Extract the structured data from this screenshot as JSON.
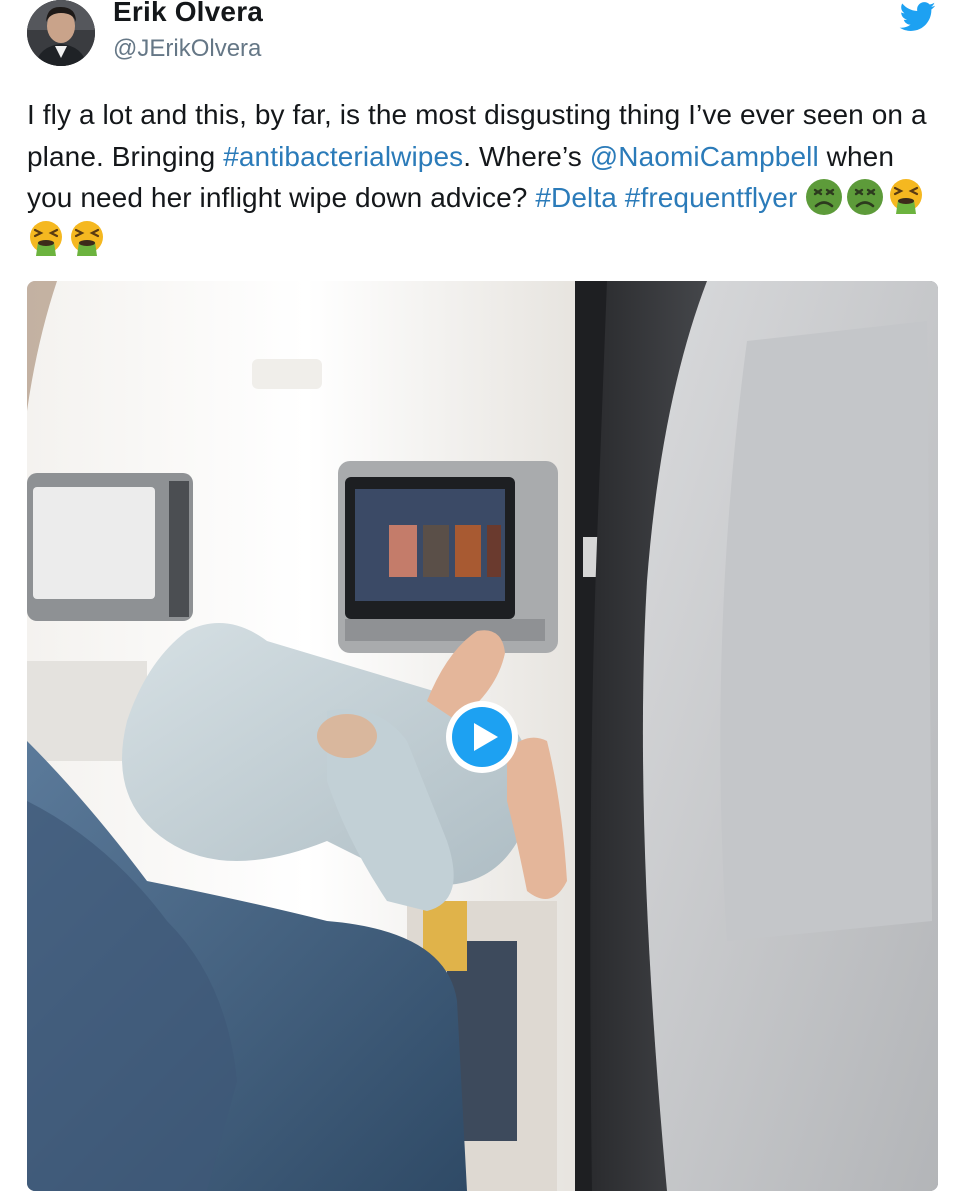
{
  "author": {
    "display_name": "Erik Olvera",
    "handle": "@JErikOlvera",
    "avatar_icon": "profile-photo"
  },
  "brand": {
    "icon": "twitter-bird-icon",
    "color": "#1da1f2"
  },
  "tweet": {
    "segments": [
      {
        "type": "text",
        "value": "I fly a lot and this, by far, is the most disgusting thing I’ve ever seen on a plane. Bringing "
      },
      {
        "type": "hashtag",
        "value": "#antibacterialwipes"
      },
      {
        "type": "text",
        "value": ". Where’s "
      },
      {
        "type": "mention",
        "value": "@NaomiCampbell"
      },
      {
        "type": "text",
        "value": " when you need her inflight wipe down advice? "
      },
      {
        "type": "hashtag",
        "value": "#Delta"
      },
      {
        "type": "text",
        "value": " "
      },
      {
        "type": "hashtag",
        "value": "#frequentflyer"
      }
    ],
    "emojis": [
      "nauseated-face",
      "nauseated-face",
      "vomiting-face",
      "vomiting-face",
      "vomiting-face"
    ],
    "link_color": "#2b7bb9"
  },
  "media": {
    "type": "video",
    "play_icon": "play-icon",
    "accent": "#1da1f2"
  }
}
